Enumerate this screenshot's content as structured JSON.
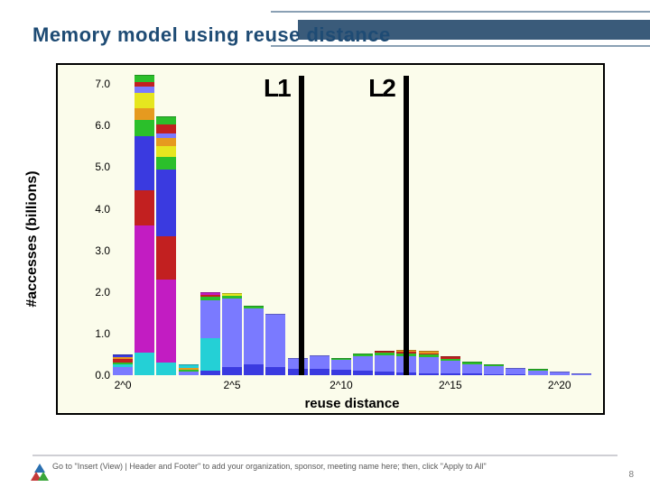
{
  "header": {
    "title": "Memory model using reuse distance"
  },
  "footer": {
    "hint": "Go to \"Insert (View) | Header and Footer\" to add your organization, sponsor, meeting name here; then, click \"Apply to All\"",
    "page_number": "8"
  },
  "chart_data": {
    "type": "bar",
    "title": "",
    "xlabel": "reuse distance",
    "ylabel": "#accesses (billions)",
    "ylim": [
      0,
      7.2
    ],
    "yticks": [
      0.0,
      1.0,
      2.0,
      3.0,
      4.0,
      5.0,
      6.0,
      7.0
    ],
    "xticks": [
      {
        "label": "2^0",
        "bin": 0
      },
      {
        "label": "2^5",
        "bin": 5
      },
      {
        "label": "2^10",
        "bin": 10
      },
      {
        "label": "2^15",
        "bin": 15
      },
      {
        "label": "2^20",
        "bin": 20
      }
    ],
    "markers": [
      {
        "label": "L1",
        "bin": 8.2
      },
      {
        "label": "L2",
        "bin": 13.0
      }
    ],
    "series_colors": {
      "s_magenta": "#c21cc2",
      "s_red": "#c22020",
      "s_blue": "#3a3ae0",
      "s_cyan": "#24d0d6",
      "s_green": "#2bbf2b",
      "s_yellow": "#e6e61f",
      "s_ltblue": "#7a7aff",
      "s_orange": "#e69a1f",
      "s_grey": "#7a7a7a"
    },
    "bars": [
      {
        "bin": 0,
        "segments": [
          {
            "c": "s_ltblue",
            "v": 0.2
          },
          {
            "c": "s_cyan",
            "v": 0.05
          },
          {
            "c": "s_green",
            "v": 0.05
          },
          {
            "c": "s_red",
            "v": 0.1
          },
          {
            "c": "s_orange",
            "v": 0.04
          },
          {
            "c": "s_blue",
            "v": 0.03
          }
        ]
      },
      {
        "bin": 1,
        "segments": [
          {
            "c": "s_cyan",
            "v": 0.55
          },
          {
            "c": "s_magenta",
            "v": 3.05
          },
          {
            "c": "s_red",
            "v": 0.85
          },
          {
            "c": "s_blue",
            "v": 1.3
          },
          {
            "c": "s_green",
            "v": 0.38
          },
          {
            "c": "s_orange",
            "v": 0.3
          },
          {
            "c": "s_yellow",
            "v": 0.35
          },
          {
            "c": "s_ltblue",
            "v": 0.15
          },
          {
            "c": "s_red",
            "v": 0.12
          },
          {
            "c": "s_green",
            "v": 0.15
          }
        ]
      },
      {
        "bin": 2,
        "segments": [
          {
            "c": "s_cyan",
            "v": 0.3
          },
          {
            "c": "s_magenta",
            "v": 2.0
          },
          {
            "c": "s_red",
            "v": 1.05
          },
          {
            "c": "s_blue",
            "v": 1.6
          },
          {
            "c": "s_green",
            "v": 0.3
          },
          {
            "c": "s_yellow",
            "v": 0.25
          },
          {
            "c": "s_orange",
            "v": 0.2
          },
          {
            "c": "s_ltblue",
            "v": 0.12
          },
          {
            "c": "s_red",
            "v": 0.2
          },
          {
            "c": "s_green",
            "v": 0.18
          }
        ]
      },
      {
        "bin": 3,
        "segments": [
          {
            "c": "s_ltblue",
            "v": 0.08
          },
          {
            "c": "s_green",
            "v": 0.05
          },
          {
            "c": "s_orange",
            "v": 0.05
          },
          {
            "c": "s_cyan",
            "v": 0.05
          }
        ]
      },
      {
        "bin": 4,
        "segments": [
          {
            "c": "s_blue",
            "v": 0.1
          },
          {
            "c": "s_cyan",
            "v": 0.8
          },
          {
            "c": "s_ltblue",
            "v": 0.9
          },
          {
            "c": "s_green",
            "v": 0.08
          },
          {
            "c": "s_red",
            "v": 0.05
          },
          {
            "c": "s_magenta",
            "v": 0.05
          }
        ]
      },
      {
        "bin": 5,
        "segments": [
          {
            "c": "s_blue",
            "v": 0.2
          },
          {
            "c": "s_ltblue",
            "v": 1.65
          },
          {
            "c": "s_green",
            "v": 0.05
          },
          {
            "c": "s_yellow",
            "v": 0.05
          }
        ]
      },
      {
        "bin": 6,
        "segments": [
          {
            "c": "s_blue",
            "v": 0.25
          },
          {
            "c": "s_ltblue",
            "v": 1.35
          },
          {
            "c": "s_green",
            "v": 0.05
          }
        ]
      },
      {
        "bin": 7,
        "segments": [
          {
            "c": "s_blue",
            "v": 0.2
          },
          {
            "c": "s_ltblue",
            "v": 1.25
          }
        ]
      },
      {
        "bin": 8,
        "segments": [
          {
            "c": "s_blue",
            "v": 0.15
          },
          {
            "c": "s_ltblue",
            "v": 0.25
          }
        ]
      },
      {
        "bin": 9,
        "segments": [
          {
            "c": "s_blue",
            "v": 0.15
          },
          {
            "c": "s_ltblue",
            "v": 0.3
          }
        ]
      },
      {
        "bin": 10,
        "segments": [
          {
            "c": "s_blue",
            "v": 0.12
          },
          {
            "c": "s_ltblue",
            "v": 0.25
          },
          {
            "c": "s_green",
            "v": 0.03
          }
        ]
      },
      {
        "bin": 11,
        "segments": [
          {
            "c": "s_blue",
            "v": 0.1
          },
          {
            "c": "s_ltblue",
            "v": 0.35
          },
          {
            "c": "s_green",
            "v": 0.04
          }
        ]
      },
      {
        "bin": 12,
        "segments": [
          {
            "c": "s_blue",
            "v": 0.08
          },
          {
            "c": "s_ltblue",
            "v": 0.4
          },
          {
            "c": "s_green",
            "v": 0.06
          },
          {
            "c": "s_red",
            "v": 0.03
          }
        ]
      },
      {
        "bin": 13,
        "segments": [
          {
            "c": "s_blue",
            "v": 0.06
          },
          {
            "c": "s_ltblue",
            "v": 0.4
          },
          {
            "c": "s_green",
            "v": 0.06
          },
          {
            "c": "s_red",
            "v": 0.04
          },
          {
            "c": "s_orange",
            "v": 0.03
          }
        ]
      },
      {
        "bin": 14,
        "segments": [
          {
            "c": "s_blue",
            "v": 0.05
          },
          {
            "c": "s_ltblue",
            "v": 0.38
          },
          {
            "c": "s_green",
            "v": 0.06
          },
          {
            "c": "s_red",
            "v": 0.04
          },
          {
            "c": "s_orange",
            "v": 0.03
          }
        ]
      },
      {
        "bin": 15,
        "segments": [
          {
            "c": "s_blue",
            "v": 0.05
          },
          {
            "c": "s_ltblue",
            "v": 0.3
          },
          {
            "c": "s_green",
            "v": 0.05
          },
          {
            "c": "s_red",
            "v": 0.03
          }
        ]
      },
      {
        "bin": 16,
        "segments": [
          {
            "c": "s_blue",
            "v": 0.04
          },
          {
            "c": "s_ltblue",
            "v": 0.22
          },
          {
            "c": "s_green",
            "v": 0.04
          }
        ]
      },
      {
        "bin": 17,
        "segments": [
          {
            "c": "s_blue",
            "v": 0.03
          },
          {
            "c": "s_ltblue",
            "v": 0.18
          },
          {
            "c": "s_green",
            "v": 0.03
          }
        ]
      },
      {
        "bin": 18,
        "segments": [
          {
            "c": "s_blue",
            "v": 0.03
          },
          {
            "c": "s_ltblue",
            "v": 0.12
          }
        ]
      },
      {
        "bin": 19,
        "segments": [
          {
            "c": "s_ltblue",
            "v": 0.1
          },
          {
            "c": "s_green",
            "v": 0.02
          }
        ]
      },
      {
        "bin": 20,
        "segments": [
          {
            "c": "s_ltblue",
            "v": 0.06
          }
        ]
      },
      {
        "bin": 21,
        "segments": [
          {
            "c": "s_ltblue",
            "v": 0.03
          }
        ]
      }
    ]
  }
}
